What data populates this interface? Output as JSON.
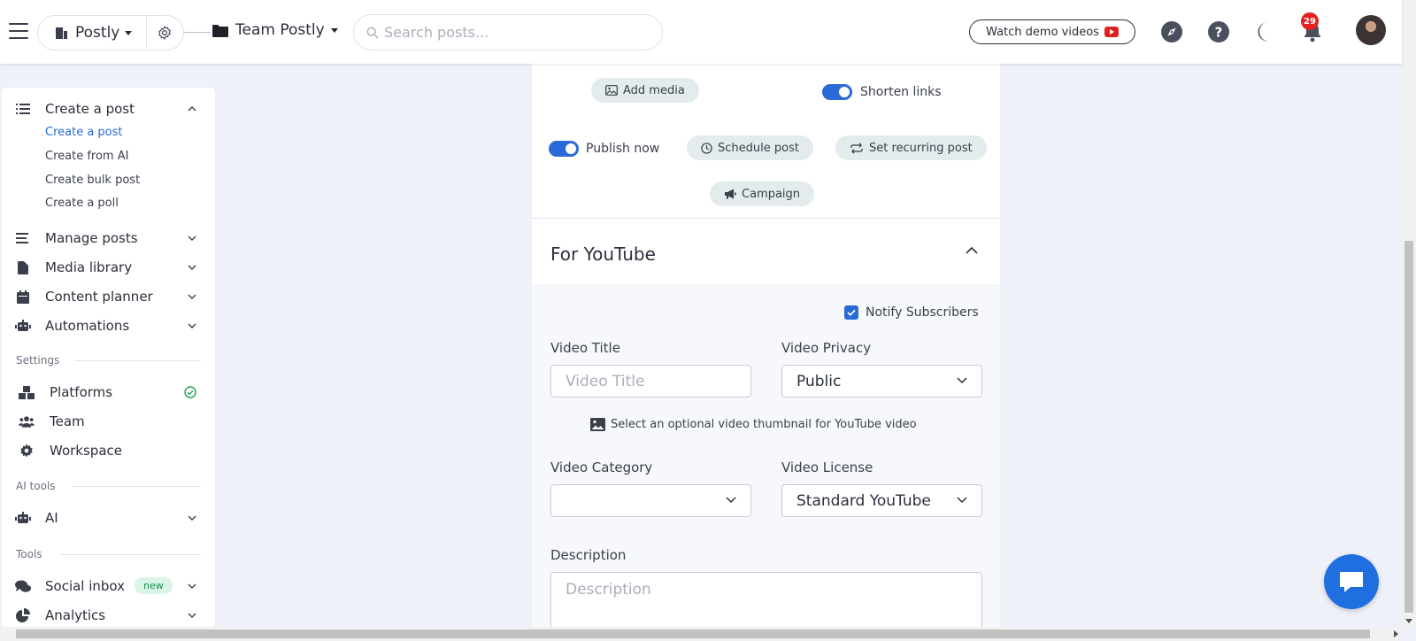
{
  "topbar": {
    "brand_name": "Postly",
    "team_name": "Team Postly",
    "search_placeholder": "Search posts...",
    "demo_button": "Watch demo videos",
    "notification_count": "29"
  },
  "sidebar": {
    "create_post": {
      "label": "Create a post",
      "sub_items": [
        "Create a post",
        "Create from AI",
        "Create bulk post",
        "Create a poll"
      ]
    },
    "manage_posts": "Manage posts",
    "media_library": "Media library",
    "content_planner": "Content planner",
    "automations": "Automations",
    "settings_heading": "Settings",
    "platforms": "Platforms",
    "team": "Team",
    "workspace": "Workspace",
    "ai_tools_heading": "AI tools",
    "ai": "AI",
    "tools_heading": "Tools",
    "social_inbox": "Social inbox",
    "social_inbox_badge": "new",
    "analytics": "Analytics"
  },
  "composer": {
    "add_media": "Add media",
    "shorten_links": "Shorten links",
    "publish_now": "Publish now",
    "schedule_post": "Schedule post",
    "set_recurring_post": "Set recurring post",
    "campaign": "Campaign"
  },
  "youtube": {
    "section_title": "For YouTube",
    "notify_subscribers": "Notify Subscribers",
    "video_title_label": "Video Title",
    "video_title_placeholder": "Video Title",
    "video_privacy_label": "Video Privacy",
    "video_privacy_value": "Public",
    "thumbnail_text": "Select an optional video thumbnail for YouTube video",
    "video_category_label": "Video Category",
    "video_category_value": "",
    "video_license_label": "Video License",
    "video_license_value": "Standard YouTube",
    "description_label": "Description",
    "description_placeholder": "Description"
  },
  "colors": {
    "accent": "#2a6ad6",
    "page_bg": "#eef1f8",
    "notification_badge": "#e52222",
    "chat_button": "#1f6fe0"
  }
}
